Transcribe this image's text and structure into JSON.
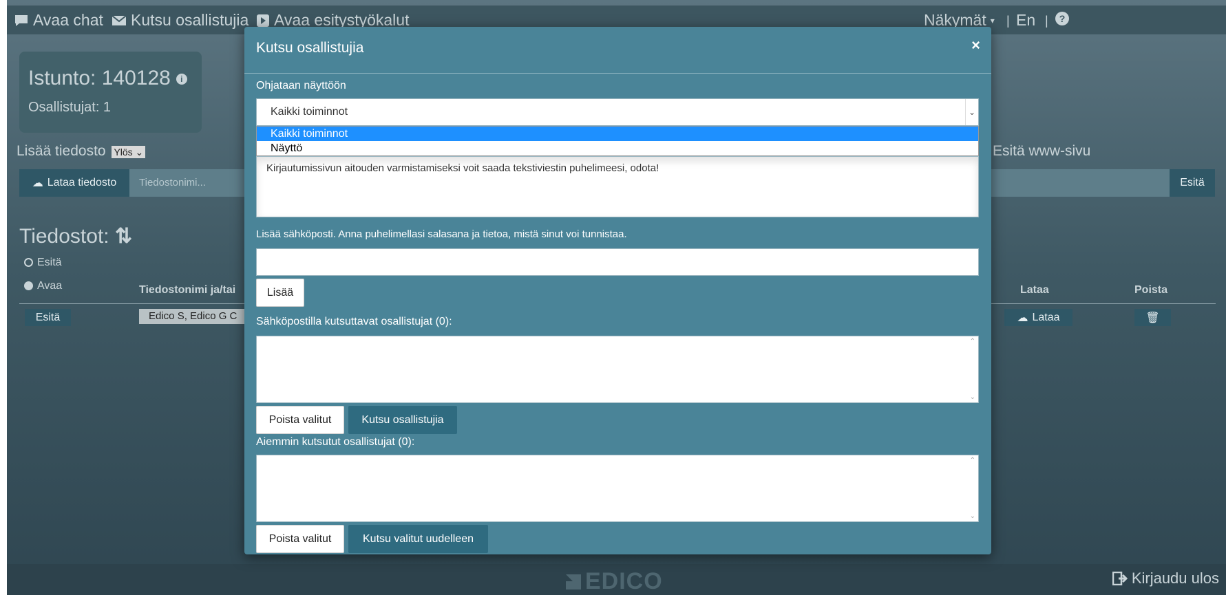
{
  "topbar": {
    "chat": "Avaa chat",
    "invite": "Kutsu osallistujia",
    "tools": "Avaa esitystyökalut",
    "views": "Näkymät",
    "lang": "En",
    "sep": "|"
  },
  "session": {
    "title": "Istunto: 140128",
    "participants": "Osallistujat: 1"
  },
  "background": {
    "add_file": "Lisää tiedosto",
    "order_select": "Ylös",
    "present_web": "Esitä www-sivu",
    "upload_button": "Lataa tiedosto",
    "filename_placeholder": "Tiedostonimi...",
    "present_button": "Esitä",
    "files_title": "Tiedostot:",
    "radio_present": "Esitä",
    "radio_open": "Avaa",
    "col_filename": "Tiedostonimi ja/tai",
    "col_download": "Lataa",
    "col_delete": "Poista",
    "row_present": "Esitä",
    "row_file": "Edico S, Edico G C",
    "row_download": "Lataa"
  },
  "modal": {
    "title": "Kutsu osallistujia",
    "close": "×",
    "screen_label": "Ohjataan näyttöön",
    "screen_selected": "Kaikki toiminnot",
    "screen_options": [
      "Kaikki toiminnot",
      "Näyttö"
    ],
    "message_text": "Kirjautumissivun aitouden varmistamiseksi voit saada tekstiviestin puhelimeesi, odota!",
    "email_label": "Lisää sähköposti. Anna puhelimellasi salasana ja tietoa, mistä sinut voi tunnistaa.",
    "email_value": "",
    "add_button": "Lisää",
    "invitees_label": "Sähköpostilla kutsuttavat osallistujat (0):",
    "remove_selected": "Poista valitut",
    "invite_button": "Kutsu osallistujia",
    "previous_label": "Aiemmin kutsutut osallistujat (0):",
    "remove_selected_2": "Poista valitut",
    "reinvite_button": "Kutsu valitut uudelleen"
  },
  "footer": {
    "logo": "EDICO",
    "logout": "Kirjaudu ulos"
  }
}
